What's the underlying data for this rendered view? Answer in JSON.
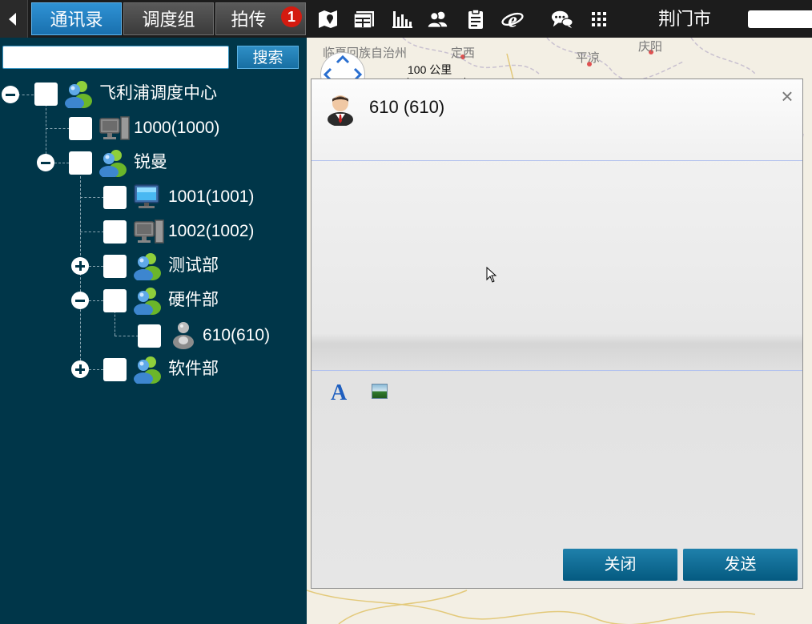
{
  "topbar": {
    "tabs": [
      {
        "label": "通讯录",
        "active": true
      },
      {
        "label": "调度组",
        "active": false
      },
      {
        "label": "拍传",
        "active": false,
        "badge": "1"
      }
    ],
    "icons": [
      "map-pin-icon",
      "window-layout-icon",
      "chart-bars-icon",
      "contacts-icon",
      "clipboard-icon",
      "browser-ie-icon",
      "chat-bubbles-icon",
      "grid-dots-icon"
    ],
    "city": "荆门市"
  },
  "sidebar": {
    "search_button": "搜索",
    "search_placeholder": "",
    "tree": [
      {
        "label": "飞利浦调度中心",
        "icon": "group-icon"
      },
      {
        "label": "1000(1000)",
        "icon": "pc-offline-icon"
      },
      {
        "label": "锐曼",
        "icon": "group-icon"
      },
      {
        "label": "1001(1001)",
        "icon": "pc-online-icon"
      },
      {
        "label": "1002(1002)",
        "icon": "pc-offline-icon"
      },
      {
        "label": "测试部",
        "icon": "group-icon"
      },
      {
        "label": "硬件部",
        "icon": "group-icon"
      },
      {
        "label": "610(610)",
        "icon": "user-offline-icon"
      },
      {
        "label": "软件部",
        "icon": "group-icon"
      }
    ]
  },
  "map": {
    "labels": [
      "临夏回族自治州",
      "定西",
      "平凉",
      "庆阳"
    ],
    "scale": "100 公里"
  },
  "dialog": {
    "title": "610 (610)",
    "close_button": "关闭",
    "send_button": "发送"
  },
  "colors": {
    "sidebar_bg": "#003649",
    "accent": "#1970ae",
    "badge": "#d41b10"
  }
}
